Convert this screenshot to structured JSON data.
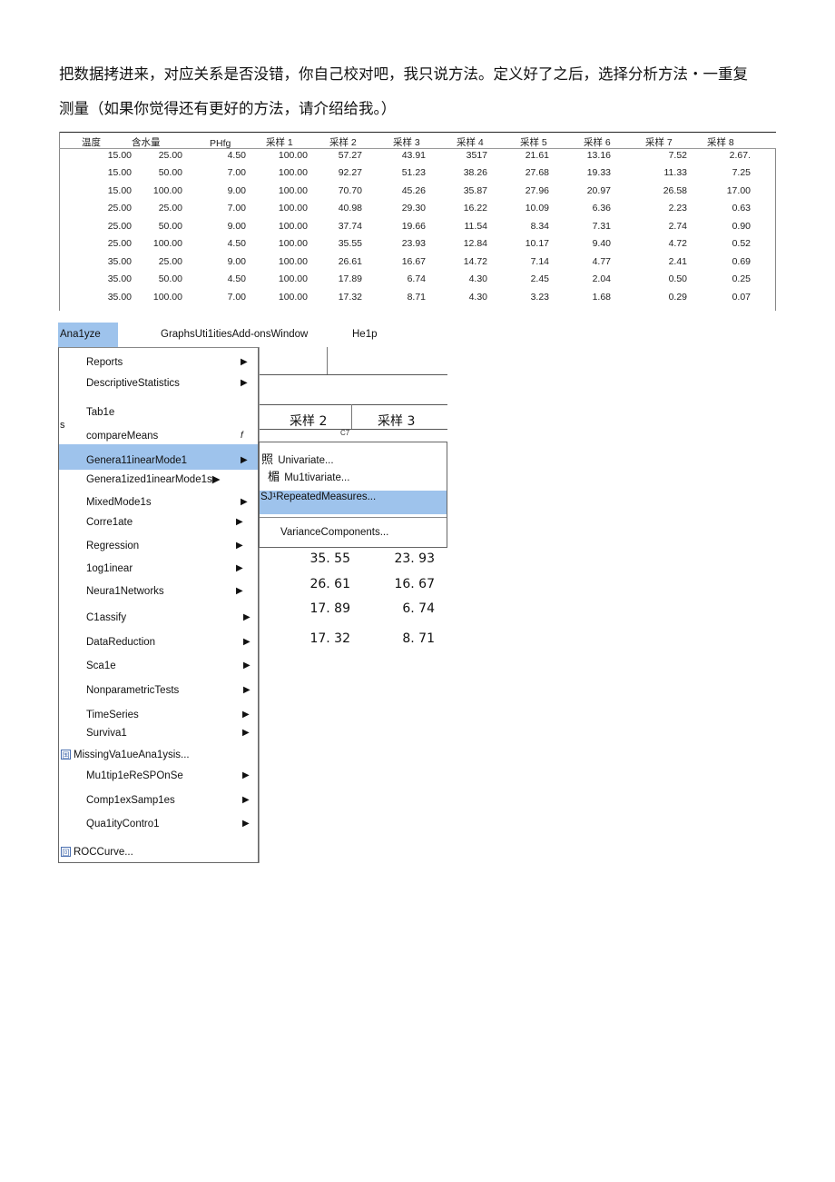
{
  "intro": {
    "line1": "把数据拷进来，对应关系是否没错，你自己校对吧，我只说方法。定义好了之后，选择分析方法・一重复",
    "line2": "测量（如果你觉得还有更好的方法，请介绍给我。）"
  },
  "table": {
    "headers": [
      "温度",
      "含水量",
      "PHfg",
      "采样 1",
      "采样 2",
      "采样 3",
      "采样 4",
      "采样 5",
      "采样 6",
      "采样 7",
      "采样 8"
    ],
    "rows": [
      [
        "15.00",
        "25.00",
        "4.50",
        "100.00",
        "57.27",
        "43.91",
        "3517",
        "21.61",
        "13.16",
        "7.52",
        "2.67."
      ],
      [
        "15.00",
        "50.00",
        "7.00",
        "100.00",
        "92.27",
        "51.23",
        "38.26",
        "27.68",
        "19.33",
        "11.33",
        "7.25"
      ],
      [
        "15.00",
        "100.00",
        "9.00",
        "100.00",
        "70.70",
        "45.26",
        "35.87",
        "27.96",
        "20.97",
        "26.58",
        "17.00"
      ],
      [
        "25.00",
        "25.00",
        "7.00",
        "100.00",
        "40.98",
        "29.30",
        "16.22",
        "10.09",
        "6.36",
        "2.23",
        "0.63"
      ],
      [
        "25.00",
        "50.00",
        "9.00",
        "100.00",
        "37.74",
        "19.66",
        "11.54",
        "8.34",
        "7.31",
        "2.74",
        "0.90"
      ],
      [
        "25.00",
        "100.00",
        "4.50",
        "100.00",
        "35.55",
        "23.93",
        "12.84",
        "10.17",
        "9.40",
        "4.72",
        "0.52"
      ],
      [
        "35.00",
        "25.00",
        "9.00",
        "100.00",
        "26.61",
        "16.67",
        "14.72",
        "7.14",
        "4.77",
        "2.41",
        "0.69"
      ],
      [
        "35.00",
        "50.00",
        "4.50",
        "100.00",
        "17.89",
        "6.74",
        "4.30",
        "2.45",
        "2.04",
        "0.50",
        "0.25"
      ],
      [
        "35.00",
        "100.00",
        "7.00",
        "100.00",
        "17.32",
        "8.71",
        "4.30",
        "3.23",
        "1.68",
        "0.29",
        "0.07"
      ]
    ]
  },
  "menubar": {
    "analyze": "Ana1yze",
    "middle": "GraphsUti1itiesAdd-onsWindow",
    "help": "He1p"
  },
  "dropdown": {
    "items": [
      {
        "label": "Reports",
        "arrow": "▶"
      },
      {
        "label": "DescriptiveStatistics",
        "arrow": "▶"
      },
      {
        "label": "Tab1e",
        "arrow": ""
      },
      {
        "label": "compareMeans",
        "arrow": "f"
      },
      {
        "label": "Genera11inearMode1",
        "arrow": "▶"
      },
      {
        "label": "Genera1ized1inearMode1s▶",
        "arrow": ""
      },
      {
        "label": "MixedMode1s",
        "arrow": "▶"
      },
      {
        "label": "Corre1ate",
        "arrow": "▶"
      },
      {
        "label": "Regression",
        "arrow": "▶"
      },
      {
        "label": "1og1inear",
        "arrow": "▶"
      },
      {
        "label": "Neura1Networks",
        "arrow": "▶"
      },
      {
        "label": "C1assify",
        "arrow": "▶"
      },
      {
        "label": "DataReduction",
        "arrow": "▶"
      },
      {
        "label": "Sca1e",
        "arrow": "▶"
      },
      {
        "label": "NonparametricTests",
        "arrow": "▶"
      },
      {
        "label": "TimeSeries",
        "arrow": "▶"
      },
      {
        "label": "Surviva1",
        "arrow": "▶"
      },
      {
        "label": "MissingVa1ueAna1ysis...",
        "icon": "国"
      },
      {
        "label": "Mu1tip1eReSPOnSe",
        "arrow": "▶"
      },
      {
        "label": "Comp1exSamp1es",
        "arrow": "▶"
      },
      {
        "label": "Qua1ityContro1",
        "arrow": "▶"
      },
      {
        "label": "ROCCurve...",
        "icon": "回"
      }
    ],
    "stray_s": "s"
  },
  "grid": {
    "col_a": "采样 2",
    "col_b": "采样 3",
    "cell_ref": "C7",
    "values": [
      [
        "35. 55",
        "23. 93"
      ],
      [
        "26. 61",
        "16. 67"
      ],
      [
        "17. 89",
        "6. 74"
      ],
      [
        "17. 32",
        "8. 71"
      ]
    ]
  },
  "submenu": {
    "items": [
      {
        "prefix": "照",
        "label": "Univariate..."
      },
      {
        "prefix": "楣",
        "label": "Mu1tivariate..."
      },
      {
        "prefix": "SJ¹",
        "label": "RepeatedMeasures..."
      },
      {
        "prefix": "",
        "label": "VarianceComponents..."
      }
    ]
  },
  "colors": {
    "highlight": "#9ec3ec"
  }
}
